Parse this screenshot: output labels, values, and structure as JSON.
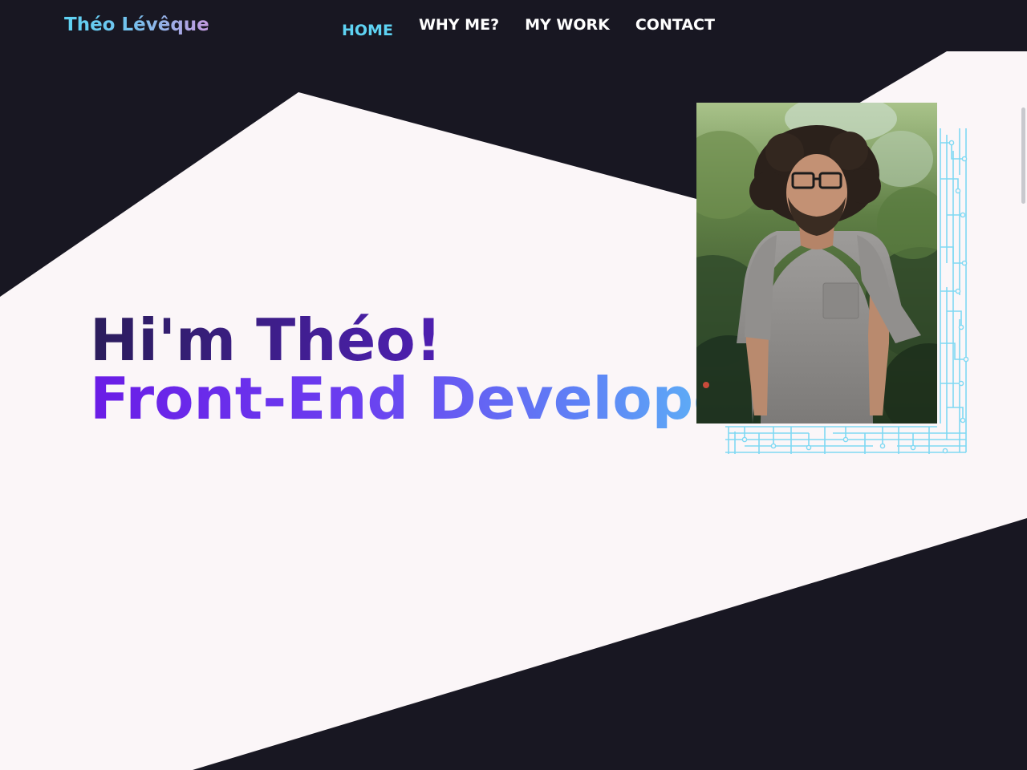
{
  "brand": {
    "name": "Théo Lévêque"
  },
  "nav": {
    "items": [
      {
        "label": "HOME",
        "active": true
      },
      {
        "label": "WHY ME?",
        "active": false
      },
      {
        "label": "MY WORK",
        "active": false
      },
      {
        "label": "CONTACT",
        "active": false
      }
    ]
  },
  "hero": {
    "greeting": "Hi'm Théo!",
    "role": "Front-End Developer"
  },
  "colors": {
    "background_dark": "#181722",
    "background_light": "#fbf6f8",
    "accent_cyan": "#5ed3f3",
    "accent_purple": "#6a20e6",
    "circuit": "#7fd9f3"
  }
}
